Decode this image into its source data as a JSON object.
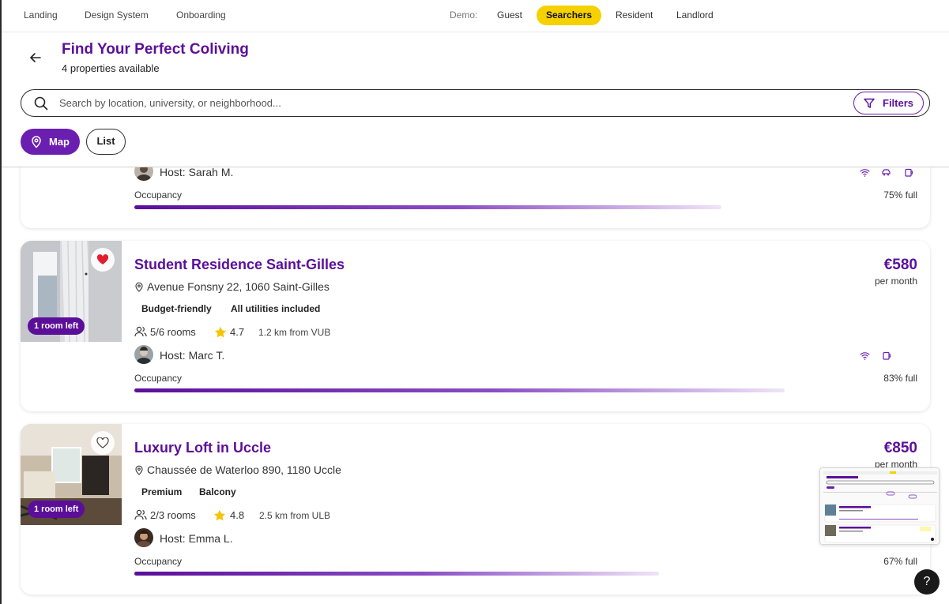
{
  "nav": {
    "links": [
      "Landing",
      "Design System",
      "Onboarding"
    ],
    "demo_label": "Demo:",
    "roles": [
      "Guest",
      "Searchers",
      "Resident",
      "Landlord"
    ],
    "active_role": "Searchers"
  },
  "header": {
    "title": "Find Your Perfect Coliving",
    "subtitle": "4 properties available",
    "search_placeholder": "Search by location, university, or neighborhood...",
    "filters_label": "Filters",
    "view_map": "Map",
    "view_list": "List",
    "active_view": "Map"
  },
  "colors": {
    "brand": "#5b0f99",
    "accent_yellow": "#f6d100",
    "star": "#f5c400",
    "heart": "#e11d2e"
  },
  "properties": [
    {
      "host": "Host: Sarah M.",
      "occupancy_label": "Occupancy",
      "occupancy_pct": "75% full",
      "occupancy_value": 0.75,
      "amenities": [
        "wifi-icon",
        "parking-icon",
        "laundry-icon"
      ]
    },
    {
      "name": "Student Residence Saint-Gilles",
      "price": "€580",
      "per": "per month",
      "address": "Avenue Fonsny 22, 1060 Saint-Gilles",
      "tags": [
        "Budget-friendly",
        "All utilities included"
      ],
      "rooms": "5/6 rooms",
      "rating": "4.7",
      "distance": "1.2 km from VUB",
      "host": "Host: Marc T.",
      "rooms_left": "1 room left",
      "favorited": true,
      "occupancy_label": "Occupancy",
      "occupancy_pct": "83% full",
      "occupancy_value": 0.83,
      "amenities": [
        "wifi-icon",
        "laundry-icon"
      ]
    },
    {
      "name": "Luxury Loft in Uccle",
      "price": "€850",
      "per": "per month",
      "address": "Chaussée de Waterloo 890, 1180 Uccle",
      "tags": [
        "Premium",
        "Balcony"
      ],
      "rooms": "2/3 rooms",
      "rating": "4.8",
      "distance": "2.5 km from ULB",
      "host": "Host: Emma L.",
      "rooms_left": "1 room left",
      "favorited": false,
      "occupancy_label": "Occupancy",
      "occupancy_pct": "67% full",
      "occupancy_value": 0.67,
      "amenities": []
    }
  ],
  "help_label": "?"
}
